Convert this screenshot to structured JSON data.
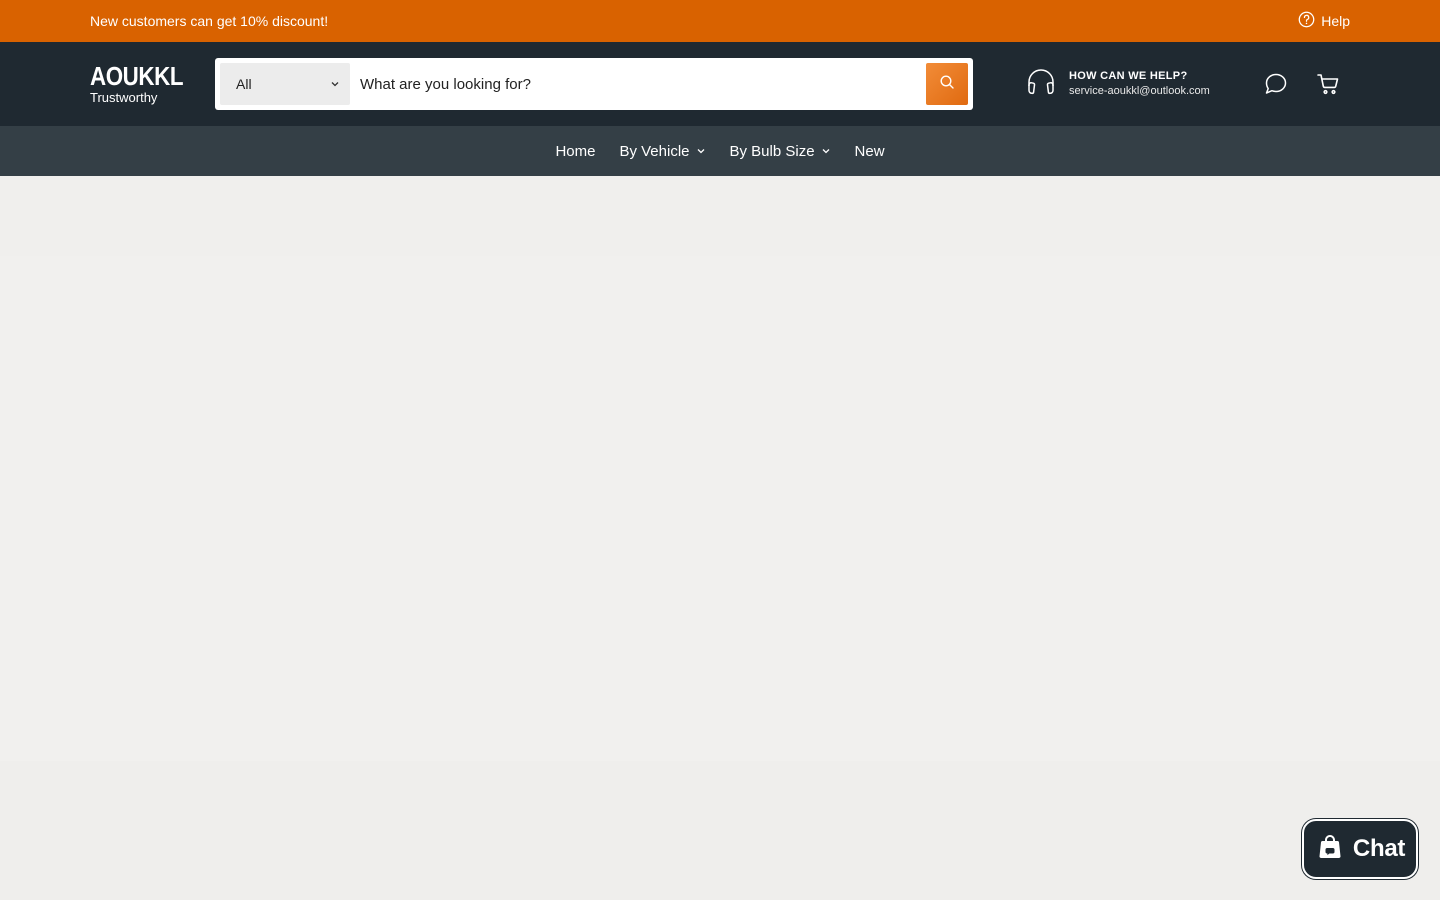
{
  "announcement": {
    "text": "New customers can get 10% discount!",
    "help_label": "Help"
  },
  "header": {
    "logo_name": "AOUKKL",
    "logo_tagline": "Trustworthy",
    "search": {
      "category": "All",
      "placeholder": "What are you looking for?"
    },
    "support": {
      "title": "HOW CAN WE HELP?",
      "email": "service-aoukkl@outlook.com"
    }
  },
  "nav": {
    "home": "Home",
    "by_vehicle": "By Vehicle",
    "by_bulb_size": "By Bulb Size",
    "new": "New"
  },
  "chat": {
    "label": "Chat"
  },
  "colors": {
    "accent": "#d96200",
    "header_bg": "#1f2931",
    "nav_bg": "#343f46"
  }
}
